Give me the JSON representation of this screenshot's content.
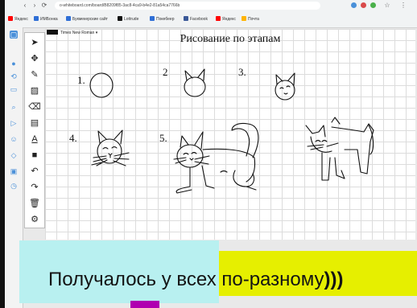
{
  "browser": {
    "url": "o-whiteboard.com/board/B8209f85-3ac8-4ca9-b4e2-81a54ca7766b",
    "bookmarks": [
      {
        "label": "Яндекс",
        "color": "#ff0000"
      },
      {
        "label": "ИМБонка",
        "color": "#2f6fd6"
      },
      {
        "label": "Букмекерские сайт",
        "color": "#2f6fd6"
      },
      {
        "label": "Lottrude",
        "color": "#111111"
      },
      {
        "label": "Покебеер",
        "color": "#2f6fd6"
      },
      {
        "label": "Facebook",
        "color": "#3b5998"
      },
      {
        "label": "Яндекс",
        "color": "#ff0000"
      },
      {
        "label": "Почта",
        "color": "#ffb400"
      }
    ]
  },
  "font_selector": {
    "label": "Times New Roman ▾"
  },
  "toolbar_icons": [
    "pointer-icon",
    "move-icon",
    "pencil-icon",
    "image-icon",
    "eraser-icon",
    "board-icon",
    "text-icon",
    "shape-icon",
    "undo-icon",
    "redo-icon",
    "delete-icon",
    "settings-icon"
  ],
  "board": {
    "title": "Рисование по этапам",
    "steps": [
      "1.",
      "2",
      "3.",
      "4.",
      "5."
    ]
  },
  "caption": {
    "text": "Получалось у всех по-разному",
    "suffix": ")))"
  },
  "colors": {
    "accent": "#4a90d9",
    "caption_cyan": "#b8f0f0",
    "caption_yellow": "#e6ef00",
    "purple": "#b000b0"
  }
}
